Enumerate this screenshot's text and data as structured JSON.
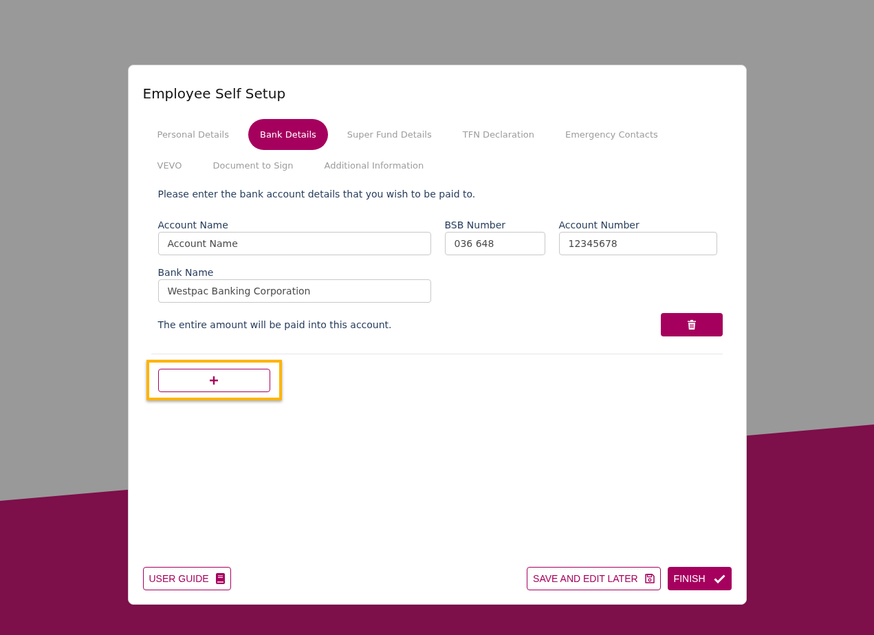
{
  "window": {
    "title": "Employee Self Setup"
  },
  "tabs": [
    {
      "label": "Personal Details",
      "selected": false
    },
    {
      "label": "Bank Details",
      "selected": true
    },
    {
      "label": "Super Fund Details",
      "selected": false
    },
    {
      "label": "TFN Declaration",
      "selected": false
    },
    {
      "label": "Emergency Contacts",
      "selected": false
    },
    {
      "label": "VEVO",
      "selected": false
    },
    {
      "label": "Document to Sign",
      "selected": false
    },
    {
      "label": "Additional Information",
      "selected": false
    }
  ],
  "bank_account": {
    "intro": "Please enter the bank account details that you wish to be paid to.",
    "field_rows": [
      [
        {
          "label": "Account Name",
          "value": "Account Name"
        },
        {
          "label": "BSB Number",
          "value": "036 648"
        },
        {
          "label": "Account Number",
          "value": "12345678"
        }
      ],
      [
        {
          "label": "Bank Name",
          "value": "Westpac Banking Corporation"
        }
      ]
    ],
    "note": "The entire amount will be paid into this account."
  },
  "add_account": {
    "highlighted": true
  },
  "footer_buttons": [
    {
      "kind": "guide",
      "label": "USER GUIDE"
    },
    {
      "kind": "save",
      "label": "SAVE AND EDIT LATER"
    },
    {
      "kind": "finish",
      "label": "FINISH"
    }
  ]
}
